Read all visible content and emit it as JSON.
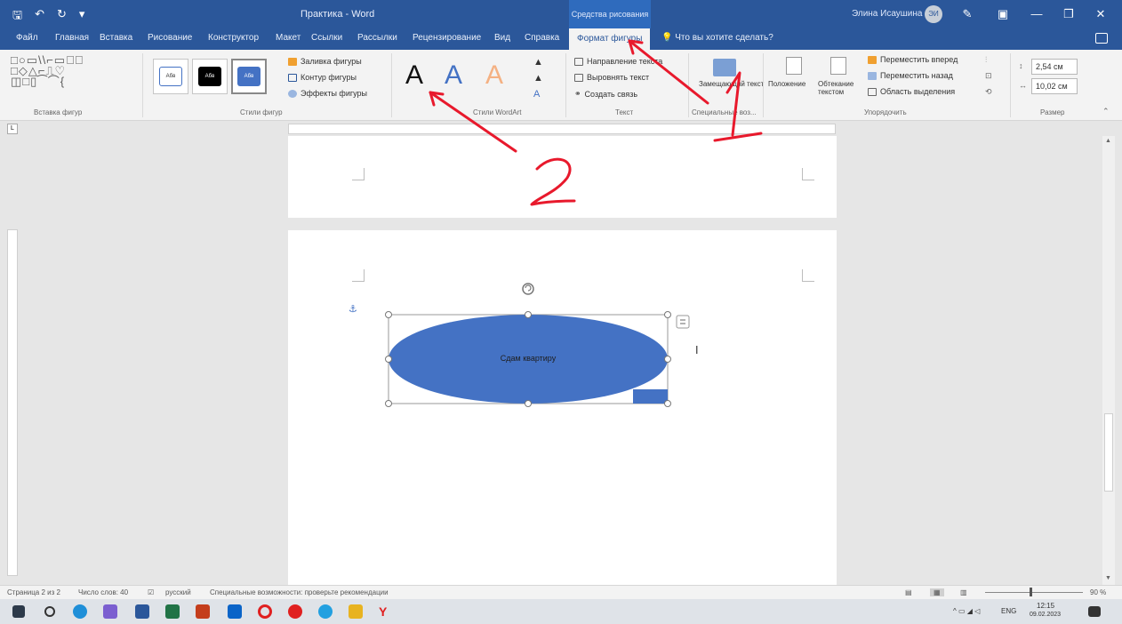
{
  "titlebar": {
    "quick_access": [
      "🖫",
      "↶",
      "↻",
      "▾"
    ],
    "title": "Практика - Word",
    "context_group": "Средства рисования",
    "user": "Элина Исаушина",
    "user_initials": "ЭИ",
    "buttons": {
      "pen": "✎",
      "layout": "▣",
      "minimize": "—",
      "restore": "❐",
      "close": "✕"
    }
  },
  "tabs": [
    "Файл",
    "Главная",
    "Вставка",
    "Рисование",
    "Конструктор",
    "Макет",
    "Ссылки",
    "Рассылки",
    "Рецензирование",
    "Вид",
    "Справка",
    "Формат фигуры"
  ],
  "tell_me": "Что вы хотите сделать?",
  "ribbon": {
    "insert_shapes": {
      "label": "Вставка фигур",
      "glyphs": "□○▭\\\\⌐▭◫⃝\n□◇△⌐⎍♡\n◫□▯⁀⌒{"
    },
    "shape_styles": {
      "label": "Стили фигур",
      "swatches": [
        "Абв",
        "Абв",
        "Абв"
      ],
      "fill": "Заливка фигуры",
      "outline": "Контур фигуры",
      "effects": "Эффекты фигуры"
    },
    "wordart": {
      "label": "Стили WordArt",
      "letters": [
        "A",
        "A",
        "A"
      ]
    },
    "text": {
      "label": "Текст",
      "direction": "Направление текста",
      "align": "Выровнять текст",
      "link": "Создать связь"
    },
    "accessibility": {
      "label": "Специальные воз...",
      "alt": "Замещающий текст"
    },
    "arrange": {
      "label": "Упорядочить",
      "position": "Положение",
      "wrap": "Обтекание текстом",
      "forward": "Переместить вперед",
      "backward": "Переместить назад",
      "selection": "Область выделения"
    },
    "size": {
      "label": "Размер",
      "height": "2,54 см",
      "width": "10,02 см"
    }
  },
  "document": {
    "shape_text": "Сдам квартиру"
  },
  "status": {
    "page": "Страница 2 из 2",
    "words": "Число слов: 40",
    "language": "русский",
    "accessibility": "Специальные возможности: проверьте рекомендации",
    "zoom": "90 %"
  },
  "taskbar": {
    "tray": "ENG",
    "time": "12:15",
    "date": "09.02.2023"
  },
  "annotations": {
    "mark1": "1",
    "mark2": "2"
  },
  "colors": {
    "word_blue": "#2b579a",
    "shape_fill": "#4472c4",
    "annotation": "#e8192c"
  }
}
